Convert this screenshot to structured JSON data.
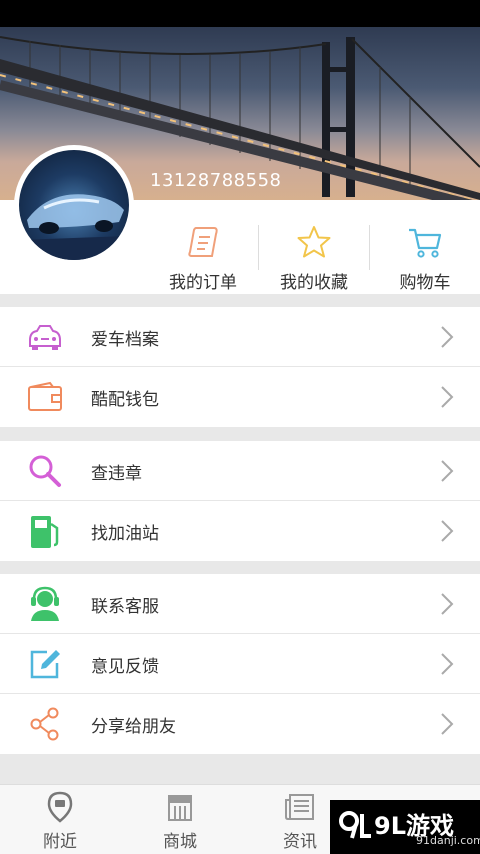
{
  "profile": {
    "phone": "13128788558"
  },
  "quick_actions": [
    {
      "label": "我的订单",
      "icon": "order-receipt-icon",
      "color": "#f0a07a"
    },
    {
      "label": "我的收藏",
      "icon": "star-icon",
      "color": "#f2c54a"
    },
    {
      "label": "购物车",
      "icon": "shopping-cart-icon",
      "color": "#4fb6dc"
    }
  ],
  "menu_groups": [
    {
      "items": [
        {
          "label": "爱车档案",
          "icon": "car-icon",
          "color": "#c65fcf"
        },
        {
          "label": "酷配钱包",
          "icon": "wallet-icon",
          "color": "#f08a5d"
        }
      ]
    },
    {
      "items": [
        {
          "label": "查违章",
          "icon": "magnifier-icon",
          "color": "#d45fd6"
        },
        {
          "label": "找加油站",
          "icon": "gas-station-icon",
          "color": "#3ec26a"
        }
      ]
    },
    {
      "items": [
        {
          "label": "联系客服",
          "icon": "customer-service-icon",
          "color": "#3ec26a"
        },
        {
          "label": "意见反馈",
          "icon": "feedback-edit-icon",
          "color": "#4fb6dc"
        },
        {
          "label": "分享给朋友",
          "icon": "share-icon",
          "color": "#f08a5d"
        }
      ]
    }
  ],
  "tabbar": [
    {
      "label": "附近",
      "icon": "location-pin-icon"
    },
    {
      "label": "商城",
      "icon": "store-icon"
    },
    {
      "label": "资讯",
      "icon": "newspaper-icon"
    }
  ],
  "watermark": {
    "title": "9L游戏",
    "url": "91danji.com"
  }
}
